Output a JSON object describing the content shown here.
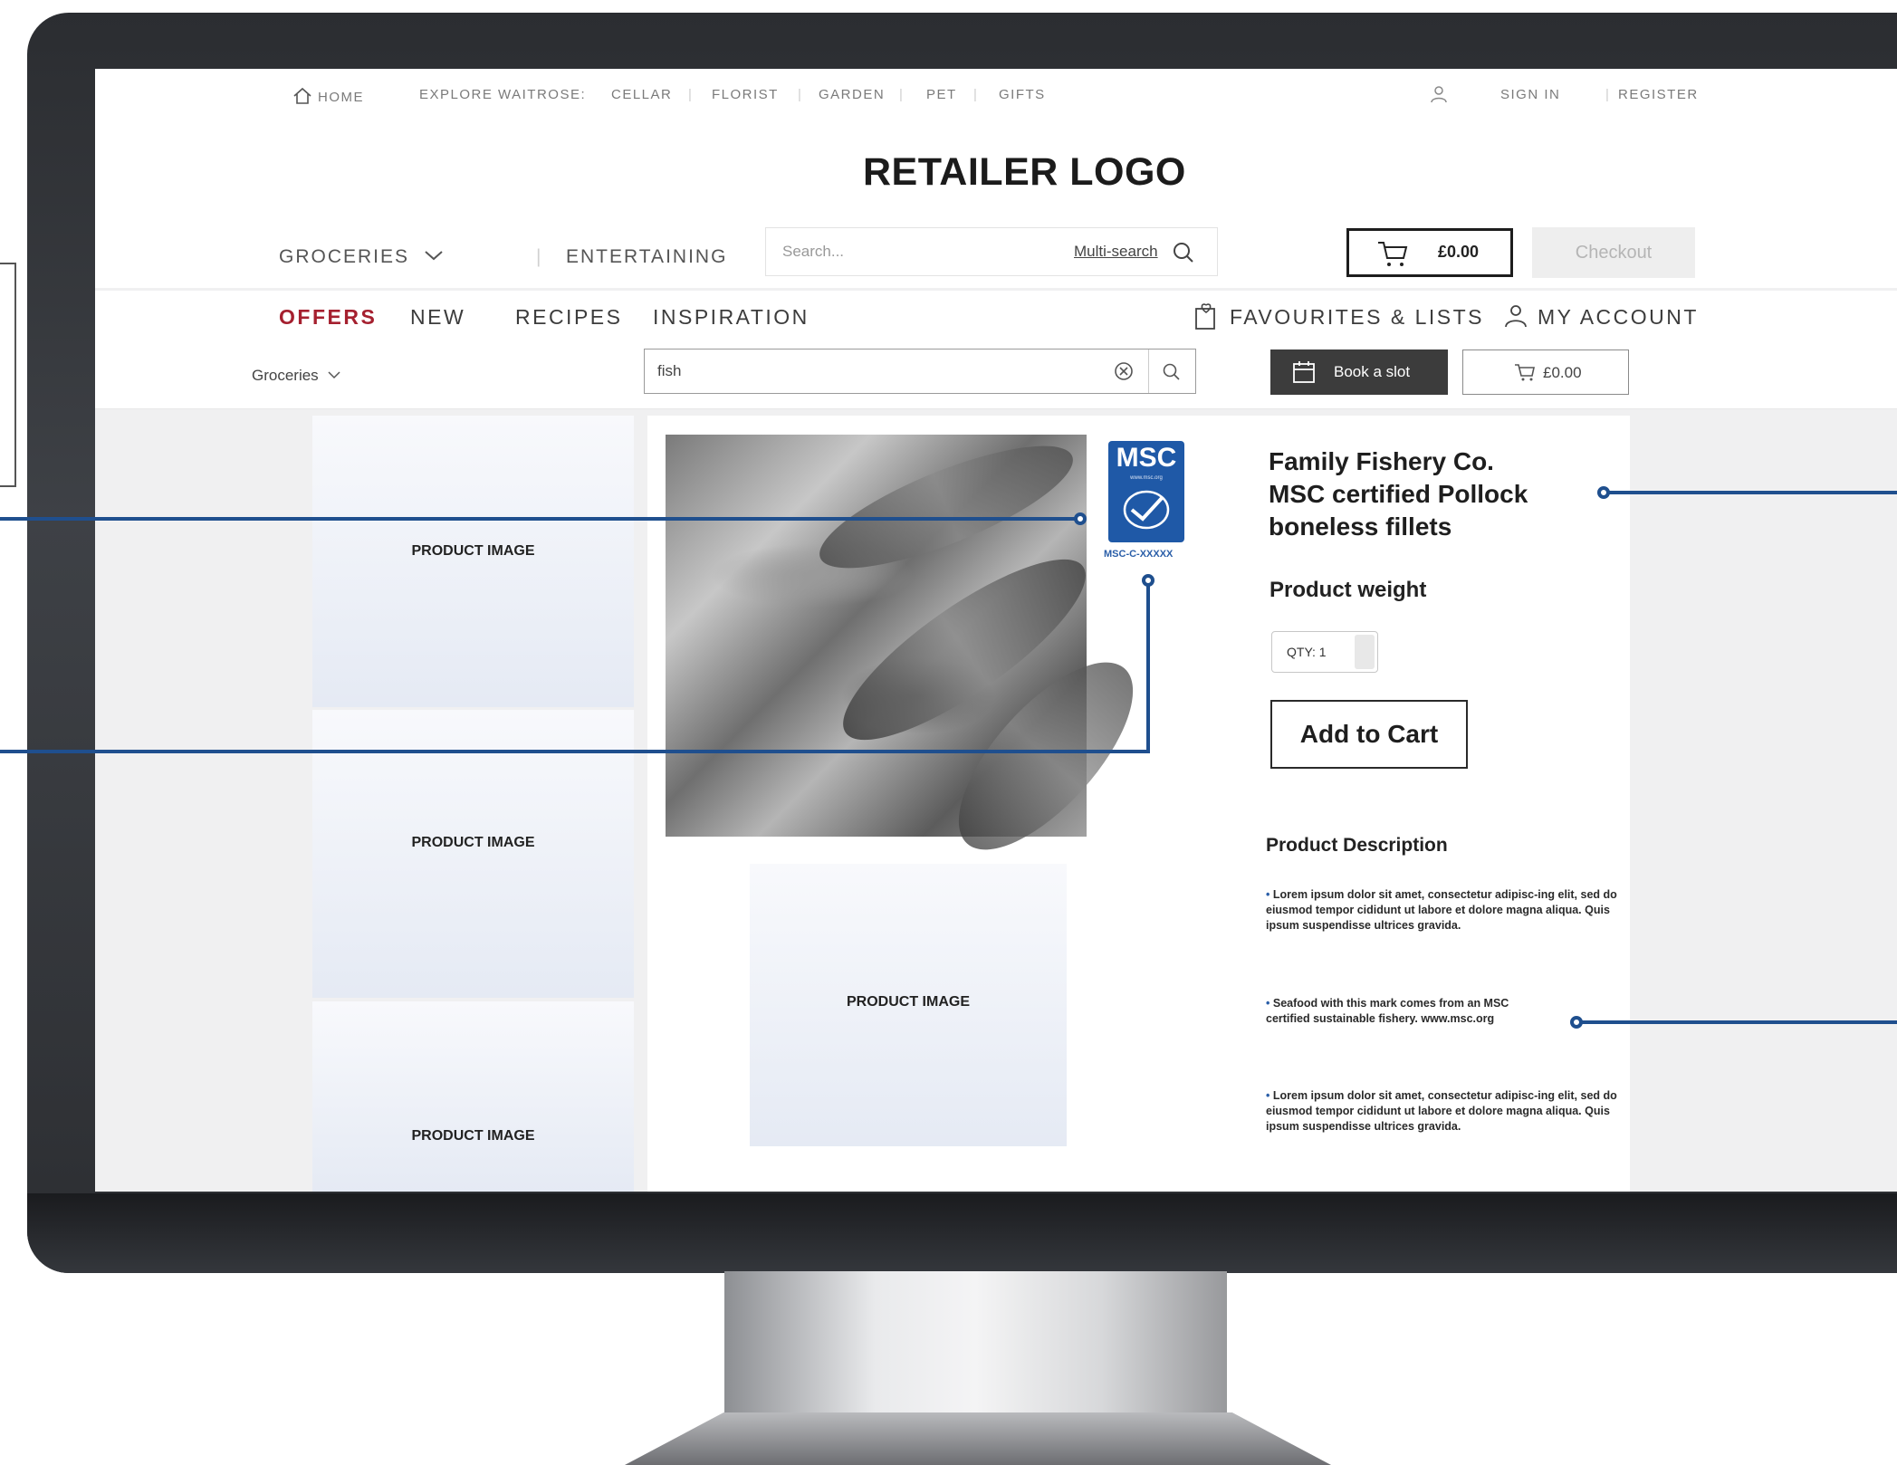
{
  "utility_bar": {
    "home": "HOME",
    "explore_label": "EXPLORE WAITROSE:",
    "links": [
      "CELLAR",
      "FLORIST",
      "GARDEN",
      "PET",
      "GIFTS"
    ],
    "sign_in": "SIGN IN",
    "register": "REGISTER"
  },
  "logo": "RETAILER LOGO",
  "main_nav": {
    "groceries": "GROCERIES",
    "entertaining": "ENTERTAINING",
    "search_placeholder": "Search...",
    "multi_search": "Multi-search",
    "cart_total": "£0.00",
    "checkout": "Checkout"
  },
  "sub_nav": {
    "items": [
      "OFFERS",
      "NEW",
      "RECIPES",
      "INSPIRATION"
    ],
    "favourites": "FAVOURITES & LISTS",
    "account": "MY ACCOUNT"
  },
  "search_bar": {
    "category": "Groceries",
    "query": "fish",
    "book_slot": "Book a slot",
    "cart_total": "£0.00"
  },
  "placeholders": {
    "label": "PRODUCT IMAGE"
  },
  "product": {
    "msc_logo": "MSC",
    "msc_url": "www.msc.org",
    "msc_code": "MSC-C-XXXXX",
    "title": "Family Fishery Co. MSC certified Pollock boneless fillets",
    "weight_label": "Product weight",
    "qty_label": "QTY: 1",
    "add_to_cart": "Add to Cart",
    "description_heading": "Product Description",
    "bullets": [
      "Lorem ipsum dolor sit amet, consectetur adipisc-ing elit, sed do eiusmod tempor cididunt ut labore et dolore magna aliqua. Quis ipsum suspendisse ultrices gravida.",
      "Seafood with this mark comes from an MSC certified sustainable fishery. www.msc.org",
      "Lorem ipsum dolor sit amet, consectetur adipisc-ing elit, sed do eiusmod tempor cididunt ut labore et dolore magna aliqua. Quis ipsum suspendisse ultrices gravida."
    ]
  },
  "colors": {
    "offers_red": "#a5202f",
    "msc_blue": "#1f59a7",
    "callout_blue": "#1f4f8e"
  }
}
